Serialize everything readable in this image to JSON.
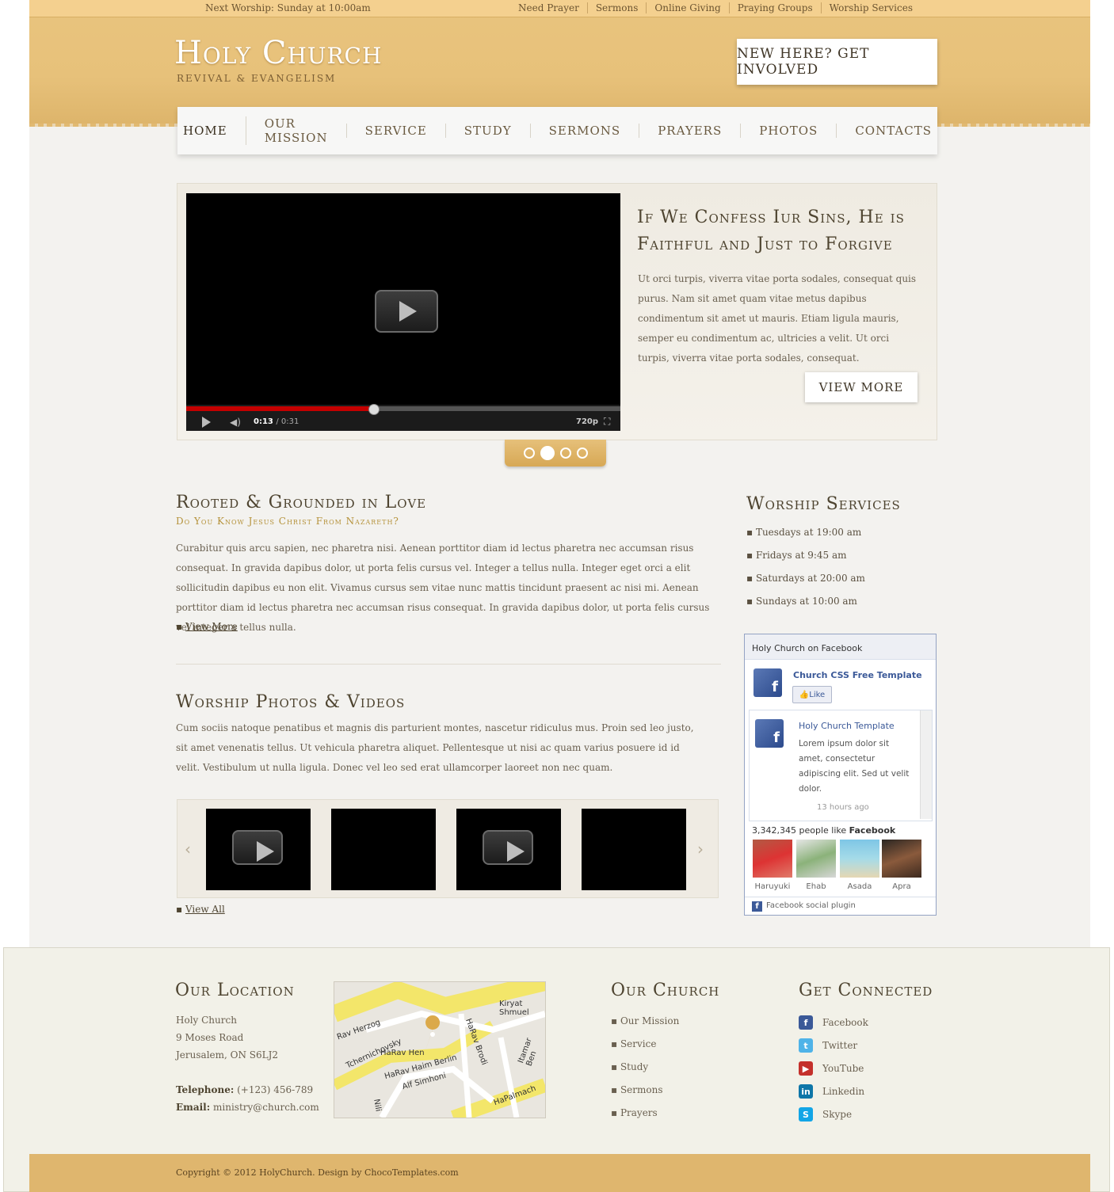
{
  "topbar": {
    "next_worship": "Next Worship: Sunday at 10:00am",
    "links": [
      "Need Prayer",
      "Sermons",
      "Online Giving",
      "Praying Groups",
      "Worship Services"
    ]
  },
  "header": {
    "logo_title": "Holy Church",
    "logo_subtitle": "REVIVAL & EVANGELISM",
    "cta_label": "NEW HERE? GET INVOLVED"
  },
  "nav": [
    "HOME",
    "OUR MISSION",
    "SERVICE",
    "STUDY",
    "SERMONS",
    "PRAYERS",
    "PHOTOS",
    "CONTACTS"
  ],
  "slider": {
    "title": "If We Confess Iur Sins, He is Faithful and Just to Forgive",
    "text": "Ut orci turpis, viverra vitae porta sodales, consequat quis purus. Nam sit amet quam vitae metus dapibus condimentum sit amet ut mauris. Etiam ligula mauris, semper eu condimentum ac, ultricies a velit. Ut orci turpis, viverra vitae porta sodales, consequat.",
    "button": "VIEW MORE",
    "video": {
      "time_current": "0:13",
      "time_total": "/ 0:31",
      "quality": "720p",
      "progress": 0.43
    },
    "dots_count": 4,
    "active_dot": 2
  },
  "about": {
    "title": "Rooted & Grounded in Love",
    "subtitle": "Do You Know Jesus Christ From Nazareth?",
    "text": "Curabitur quis arcu sapien, nec pharetra nisi. Aenean porttitor diam id lectus pharetra nec accumsan risus consequat. In gravida dapibus dolor, ut porta felis cursus vel. Integer a tellus nulla. Integer eget orci a elit sollicitudin dapibus eu non elit. Vivamus cursus sem vitae nunc mattis tincidunt praesent ac nisi mi. Aenean porttitor diam id lectus pharetra nec accumsan risus consequat. In gravida dapibus dolor, ut porta felis cursus vel integer a tellus nulla.",
    "more_label": "View More"
  },
  "photos": {
    "title": "Worship Photos & Videos",
    "text": "Cum sociis natoque penatibus et magnis dis parturient montes, nascetur ridiculus mus. Proin sed leo justo, sit amet venenatis tellus. Ut vehicula pharetra aliquet. Pellentesque ut nisi ac quam varius posuere id id velit. Vestibulum ut nulla ligula. Donec vel leo sed erat ullamcorper laoreet non nec quam.",
    "view_all": "View All"
  },
  "worship_services": {
    "title": "Worship Services",
    "items": [
      "Tuesdays at 19:00 am",
      "Fridays at 9:45 am",
      "Saturdays at 20:00 am",
      "Sundays at 10:00 am"
    ]
  },
  "facebook": {
    "header": "Holy Church on Facebook",
    "page_name": "Church CSS Free Template",
    "like": "Like",
    "post_title": "Holy Church Template",
    "post_text": "Lorem ipsum dolor sit amet, consectetur adipiscing elit. Sed ut velit dolor.",
    "post_time": "13 hours ago",
    "count_text": "3,342,345 people like",
    "count_brand": "Facebook",
    "faces": [
      "Haruyuki",
      "Ehab",
      "Asada",
      "Apra"
    ],
    "footer": "Facebook social plugin"
  },
  "footer": {
    "location_title": "Our Location",
    "address": [
      "Holy Church",
      "9 Moses Road",
      "Jerusalem, ON S6LJ2"
    ],
    "telephone_label": "Telephone:",
    "telephone": "(+123) 456-789",
    "email_label": "Email:",
    "email": "ministry@church.com",
    "map_labels": [
      "Kiryat Shmuel",
      "Rav Herzog",
      "Tchernichovsky",
      "HaRav Hen",
      "HaRav Haim Berlin",
      "Alf Simhoni",
      "HaRav Brodi",
      "Itamar Ben",
      "HaPalmach",
      "Nili"
    ],
    "church_title": "Our Church",
    "church_links": [
      "Our Mission",
      "Service",
      "Study",
      "Sermons",
      "Prayers"
    ],
    "connect_title": "Get Connected",
    "social": [
      {
        "label": "Facebook",
        "icon": "facebook-icon",
        "color": "#3b5998",
        "glyph": "f"
      },
      {
        "label": "Twitter",
        "icon": "twitter-icon",
        "color": "#4fb3e8",
        "glyph": "t"
      },
      {
        "label": "YouTube",
        "icon": "youtube-icon",
        "color": "#c4302b",
        "glyph": "▶"
      },
      {
        "label": "Linkedin",
        "icon": "linkedin-icon",
        "color": "#0e76a8",
        "glyph": "in"
      },
      {
        "label": "Skype",
        "icon": "skype-icon",
        "color": "#12a5e6",
        "glyph": "S"
      }
    ],
    "copyright": "Copyright © 2012 HolyChurch. Design by ChocoTemplates.com"
  }
}
